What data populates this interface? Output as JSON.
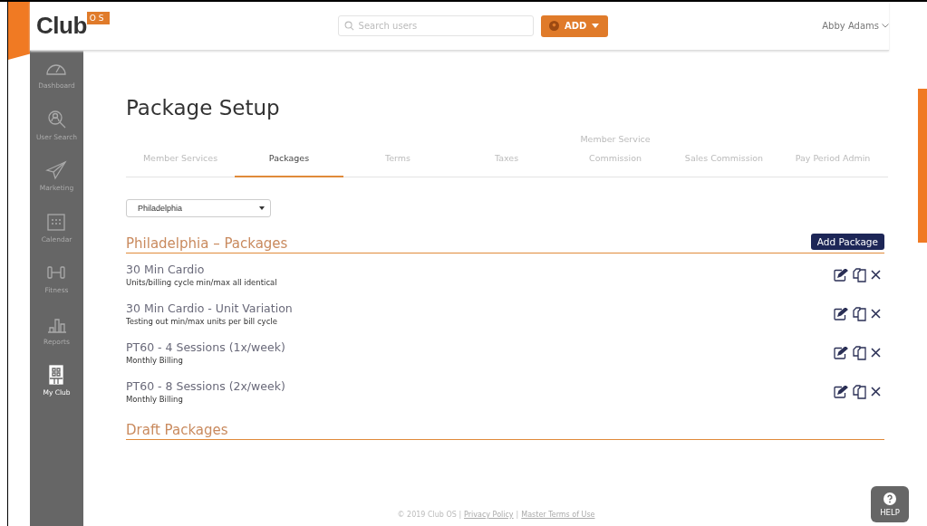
{
  "header": {
    "logo": {
      "text": "Club",
      "badge": "OS"
    },
    "search": {
      "placeholder": "Search users"
    },
    "add_button": "ADD",
    "user_menu": "Abby Adams"
  },
  "sidebar": {
    "items": [
      {
        "label": "Dashboard",
        "selected": false
      },
      {
        "label": "User Search",
        "selected": false
      },
      {
        "label": "Marketing",
        "selected": false
      },
      {
        "label": "Calendar",
        "selected": false
      },
      {
        "label": "Fitness",
        "selected": false
      },
      {
        "label": "Reports",
        "selected": false
      },
      {
        "label": "My Club",
        "selected": true
      }
    ]
  },
  "page_title": "Package Setup",
  "tabs": [
    {
      "label": "Member Services",
      "selected": false
    },
    {
      "label": "Packages",
      "selected": true
    },
    {
      "label": "Terms",
      "selected": false
    },
    {
      "label": "Taxes",
      "selected": false
    },
    {
      "label": "Member Service Commission",
      "selected": false
    },
    {
      "label": "Sales Commission",
      "selected": false
    },
    {
      "label": "Pay Period Admin",
      "selected": false
    }
  ],
  "location_select": {
    "value": "Philadelphia"
  },
  "packages_section": {
    "title": "Philadelphia – Packages",
    "add_button": "Add Package",
    "packages": [
      {
        "name": "30 Min Cardio",
        "description": "Units/billing cycle min/max all identical"
      },
      {
        "name": "30 Min Cardio - Unit Variation",
        "description": "Testing out min/max units per bill cycle"
      },
      {
        "name": "PT60 - 4 Sessions (1x/week)",
        "description": "Monthly Billing"
      },
      {
        "name": "PT60 - 8 Sessions (2x/week)",
        "description": "Monthly Billing"
      }
    ]
  },
  "drafts_section": {
    "title": "Draft Packages"
  },
  "footer": {
    "copyright": "© 2019 Club OS |",
    "links": [
      "Privacy Policy",
      "Master Terms of Use"
    ],
    "separator": "|"
  },
  "help_button": "HELP"
}
